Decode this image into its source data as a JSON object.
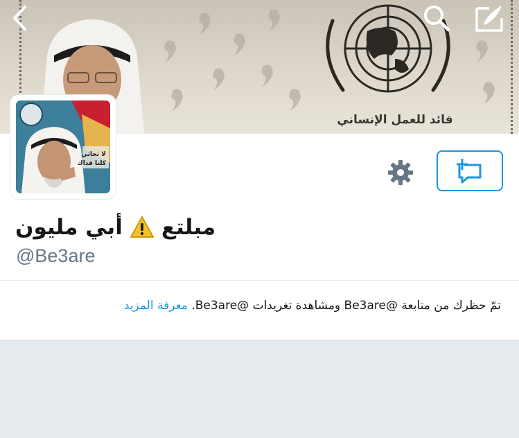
{
  "header": {
    "banner_caption": "قائد للعمل الإنساني",
    "back_icon": "chevron-left-icon",
    "search_icon": "search-icon",
    "compose_icon": "compose-icon"
  },
  "profile": {
    "avatar_text_line1": "لا تحاتي",
    "avatar_text_line2": "كلنا فداك",
    "display_name_part1": "مبلتع",
    "display_name_part2": "أبي مليون",
    "warning_icon": "warning-icon",
    "screen_name": "@Be3are"
  },
  "actions": {
    "settings_icon": "gear-icon",
    "message_icon": "new-message-icon"
  },
  "notice": {
    "text": "تمّ حظرك من متابعة @Be3are ومشاهدة تغريدات @Be3are.",
    "learn_more": "معرفة المزيد"
  },
  "colors": {
    "accent": "#1b95e0",
    "text": "#14171a",
    "muted": "#657786",
    "background": "#e6ecf0"
  }
}
